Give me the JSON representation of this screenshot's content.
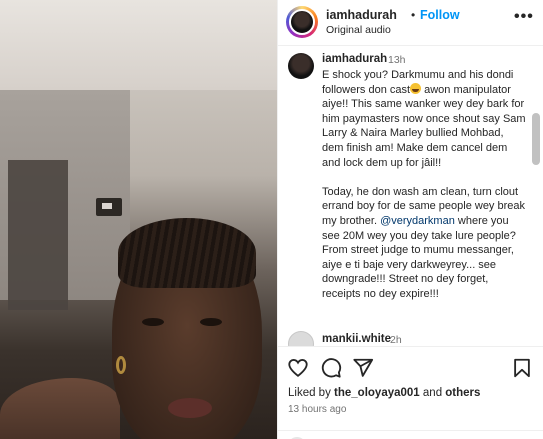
{
  "header": {
    "username": "iamhadurah",
    "separator": "•",
    "follow_label": "Follow",
    "audio_label": "Original audio",
    "more_icon": "more-horizontal-icon"
  },
  "comment": {
    "username": "iamhadurah",
    "time": "13h",
    "paragraphs": {
      "p1_a": "E shock you? Darkmumu and his dondi followers don cast",
      "p1_b": " awon manipulator aiye!! This same wanker wey dey bark for him paymasters now once shout say Sam Larry & Naira Marley bullied Mohbad, dem finish am! Make dem cancel dem and lock dem up for jâil!!",
      "p2_a": "Today, he don wash am clean, turn clout errand boy for de same people wey break my brother. ",
      "mention": "@verydarkman",
      "p2_b": " where you see 20M wey you dey take lure people? From street judge to mumu messanger, aiye e ti baje very darkweyrey... see downgrade!!! Street no dey forget, receipts no dey expire!!!"
    },
    "emoji_icon": "grinning-sweat-emoji-icon"
  },
  "comment2": {
    "username": "mankii.white",
    "time": "2h"
  },
  "actions": {
    "like_icon": "heart-icon",
    "comment_icon": "comment-icon",
    "share_icon": "send-icon",
    "save_icon": "bookmark-icon",
    "liked_by_prefix": "Liked by ",
    "liked_by_user": "the_oloyaya001",
    "liked_by_and": " and ",
    "liked_by_others": "others",
    "post_time": "13 hours ago"
  },
  "colors": {
    "link_blue": "#0095f6",
    "mention_blue": "#00376b",
    "text": "#262626",
    "muted": "#737373"
  }
}
